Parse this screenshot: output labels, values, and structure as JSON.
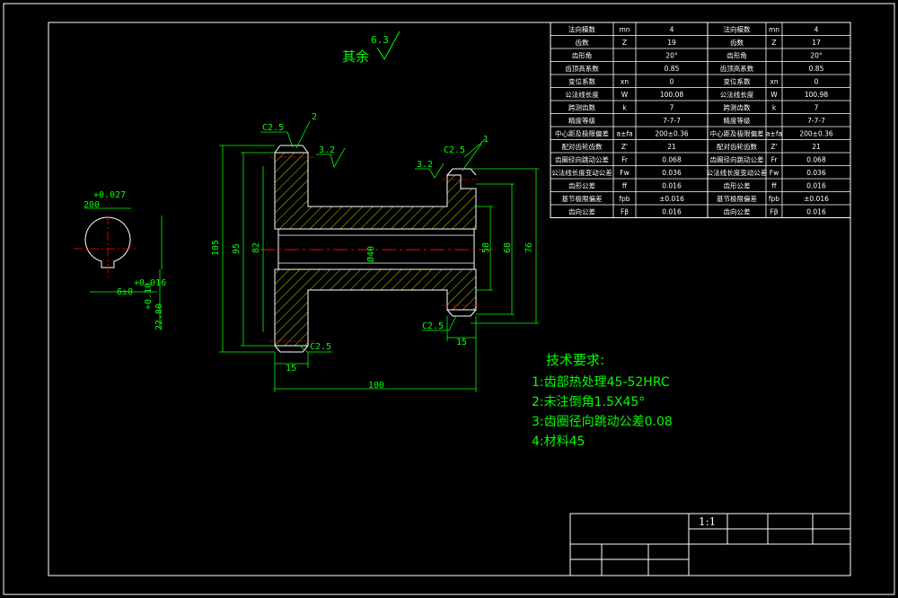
{
  "colors": {
    "background": "#000000",
    "frame": "#ffffff",
    "geometry": "#ffffff",
    "dimension": "#00ff00",
    "text_green": "#00ff00",
    "hatch": "#ffff00",
    "centerline": "#ff0000",
    "table_text": "#ffffff"
  },
  "roughness": {
    "general_value": "6.3",
    "general_label": "其余",
    "surface1": "3.2",
    "surface2": "3.2"
  },
  "chamfers": {
    "c_top_left": "C2.5",
    "c_top_right": "C2.5",
    "c_bottom_left": "C2.5",
    "c_bottom_right": "C2.5"
  },
  "balloons": {
    "left_gear": "2",
    "right_gear": "1"
  },
  "dimensions": {
    "d105": "105",
    "d95": "95",
    "d82": "82",
    "d40": "Ø40",
    "d58": "58",
    "d68": "68",
    "d76": "76",
    "w15_left": "15",
    "w15_right": "15",
    "len100": "100",
    "key_tol_top": "+0.027",
    "key_width_top": "200",
    "key_6": "6±0",
    "key_tol_016": "+0.016",
    "key_tol_10": "+0.10",
    "key_2280": "22.80"
  },
  "tech_requirements": {
    "title": "技术要求:",
    "items": [
      "1:齿部热处理45-52HRC",
      "2:未注倒角1.5X45°",
      "3:齿圈径向跳动公差0.08",
      "4:材料45"
    ]
  },
  "gear_table": {
    "rows": [
      [
        "法向模数",
        "mn",
        "4",
        "法向模数",
        "mn",
        "4"
      ],
      [
        "齿数",
        "Z",
        "19",
        "齿数",
        "Z",
        "17"
      ],
      [
        "齿形角",
        "",
        "20°",
        "齿形角",
        "",
        "20°"
      ],
      [
        "齿顶高系数",
        "",
        "0.85",
        "齿顶高系数",
        "",
        "0.85"
      ],
      [
        "变位系数",
        "xn",
        "0",
        "变位系数",
        "xn",
        "0"
      ],
      [
        "公法线长度",
        "W",
        "100.08",
        "公法线长度",
        "W",
        "100.98"
      ],
      [
        "跨测齿数",
        "k",
        "7",
        "跨测齿数",
        "k",
        "7"
      ],
      [
        "精度等级",
        "",
        "7-7-7",
        "精度等级",
        "",
        "7-7-7"
      ],
      [
        "中心距及极限偏差",
        "a±fa",
        "200±0.36",
        "中心距及极限偏差",
        "a±fa",
        "200±0.36"
      ],
      [
        "配对齿轮齿数",
        "Z'",
        "21",
        "配对齿轮齿数",
        "Z'",
        "21"
      ],
      [
        "齿圈径向跳动公差",
        "Fr",
        "0.068",
        "齿圈径向跳动公差",
        "Fr",
        "0.068"
      ],
      [
        "公法线长度变动公差",
        "Fw",
        "0.036",
        "公法线长度变动公差",
        "Fw",
        "0.036"
      ],
      [
        "齿形公差",
        "ff",
        "0.016",
        "齿形公差",
        "ff",
        "0.016"
      ],
      [
        "基节极限偏差",
        "fpb",
        "±0.016",
        "基节极限偏差",
        "fpb",
        "±0.016"
      ],
      [
        "齿向公差",
        "Fβ",
        "0.016",
        "齿向公差",
        "Fβ",
        "0.016"
      ]
    ]
  },
  "title_block": {
    "scale": "1:1"
  }
}
